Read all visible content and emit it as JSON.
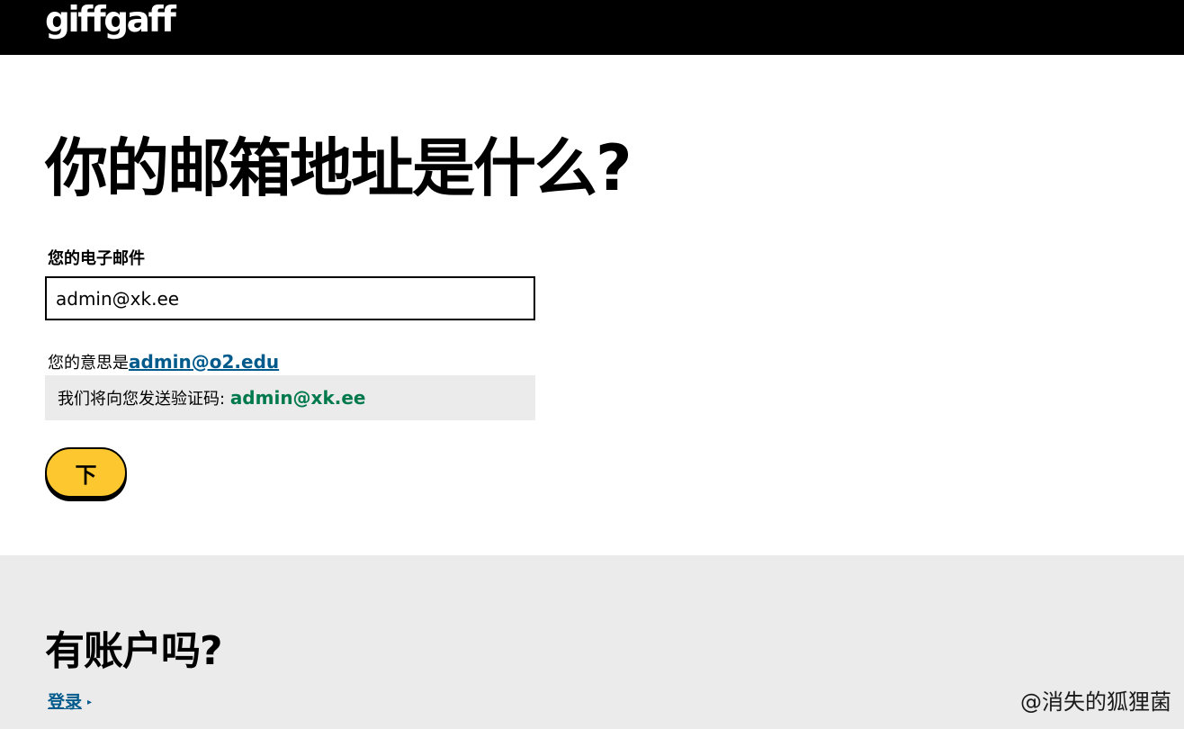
{
  "header": {
    "logo_text": "giffgaff"
  },
  "main": {
    "title": "你的邮箱地址是什么?",
    "email_label": "您的电子邮件",
    "email_value": "admin@xk.ee",
    "suggestion_prefix": "您的意思是",
    "suggestion_email": "admin@o2.edu",
    "notice_prefix": "我们将向您发送验证码:",
    "notice_email": "admin@xk.ee",
    "next_button_label": "下"
  },
  "footer": {
    "title": "有账户吗?",
    "login_label": "登录",
    "login_arrow": "▸",
    "watermark": "@消失的狐狸菌"
  },
  "colors": {
    "header_bg": "#000000",
    "button_yellow": "#fdc82f",
    "link_blue": "#005a8c",
    "email_green": "#007a4d",
    "panel_gray": "#ebebeb"
  }
}
